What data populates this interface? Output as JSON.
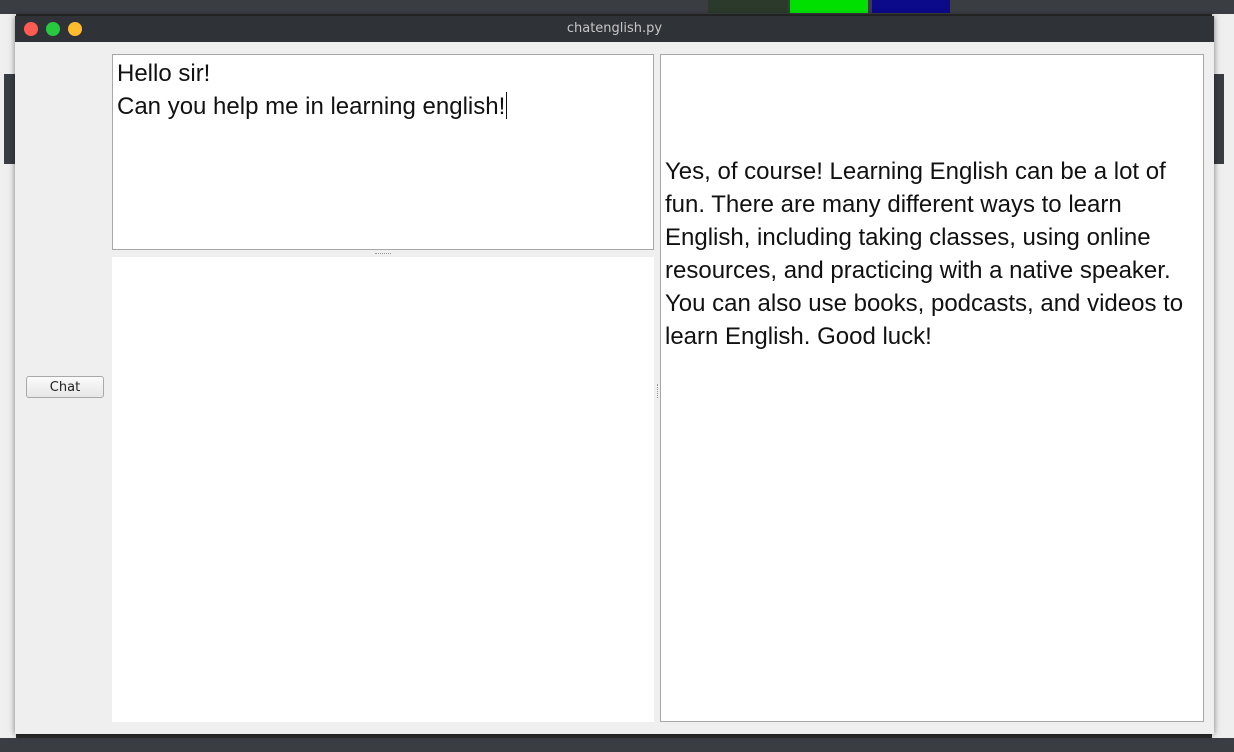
{
  "window": {
    "title": "chatenglish.py"
  },
  "toolbar": {
    "chat_label": "Chat"
  },
  "input": {
    "text": "Hello sir!\nCan you help me in learning english!"
  },
  "response": {
    "text": "\nYes, of course! Learning English can be a lot of fun. There are many different ways to learn English, including taking classes, using online resources, and practicing with a native speaker. You can also use books, podcasts, and videos to learn English. Good luck!"
  },
  "colors": {
    "close": "#ff5b52",
    "maximize": "#27c93f",
    "minimize": "#ffbd2e",
    "titlebar": "#2f3237"
  }
}
